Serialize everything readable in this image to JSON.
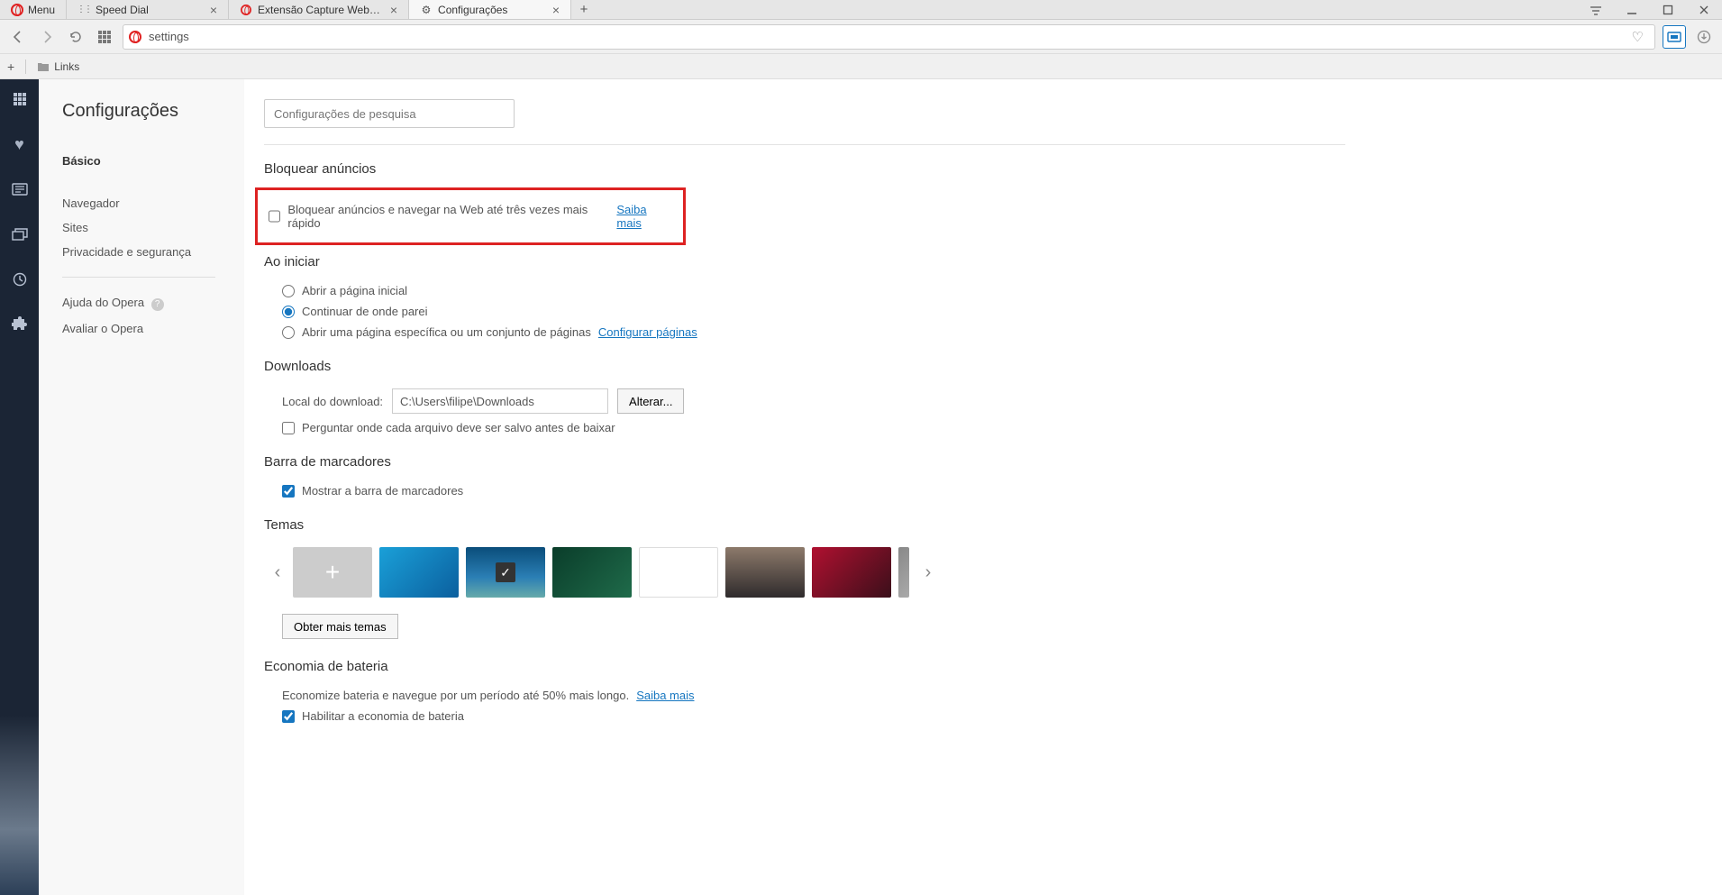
{
  "titlebar": {
    "menu_label": "Menu",
    "tabs": [
      {
        "title": "Speed Dial"
      },
      {
        "title": "Extensão Capture Webpag"
      },
      {
        "title": "Configurações"
      }
    ]
  },
  "navbar": {
    "address": "settings"
  },
  "bookbar": {
    "links_label": "Links"
  },
  "sidebar": {
    "title": "Configurações",
    "items": [
      {
        "label": "Básico"
      },
      {
        "label": "Navegador"
      },
      {
        "label": "Sites"
      },
      {
        "label": "Privacidade e segurança"
      },
      {
        "label": "Ajuda do Opera"
      },
      {
        "label": "Avaliar o Opera"
      }
    ]
  },
  "content": {
    "search_placeholder": "Configurações de pesquisa",
    "ads": {
      "heading": "Bloquear anúncios",
      "checkbox_label": "Bloquear anúncios e navegar na Web até três vezes mais rápido",
      "learn_more": "Saiba mais"
    },
    "startup": {
      "heading": "Ao iniciar",
      "opt1": "Abrir a página inicial",
      "opt2": "Continuar de onde parei",
      "opt3": "Abrir uma página específica ou um conjunto de páginas",
      "configure": "Configurar páginas"
    },
    "downloads": {
      "heading": "Downloads",
      "location_label": "Local do download:",
      "path": "C:\\Users\\filipe\\Downloads",
      "change_btn": "Alterar...",
      "ask_label": "Perguntar onde cada arquivo deve ser salvo antes de baixar"
    },
    "bookmarks": {
      "heading": "Barra de marcadores",
      "show_label": "Mostrar a barra de marcadores"
    },
    "themes": {
      "heading": "Temas",
      "more_btn": "Obter mais temas"
    },
    "battery": {
      "heading": "Economia de bateria",
      "desc": "Economize bateria e navegue por um período até 50% mais longo.",
      "learn_more": "Saiba mais",
      "enable_label": "Habilitar a economia de bateria"
    }
  },
  "theme_colors": {
    "t1": "linear-gradient(135deg,#1aa0d8,#0b5f9e)",
    "t2": "linear-gradient(180deg,#0a4d7a,#2b7fb5 60%,#6aa 100%)",
    "t3": "linear-gradient(135deg,#0a3d2a,#1f6b4a)",
    "t4": "#ffffff",
    "t5": "linear-gradient(180deg,#8d7a6b,#2f2b2c)",
    "t6": "linear-gradient(135deg,#b01030,#3a0f1a)",
    "t7": "linear-gradient(135deg,#888,#aaa)"
  }
}
